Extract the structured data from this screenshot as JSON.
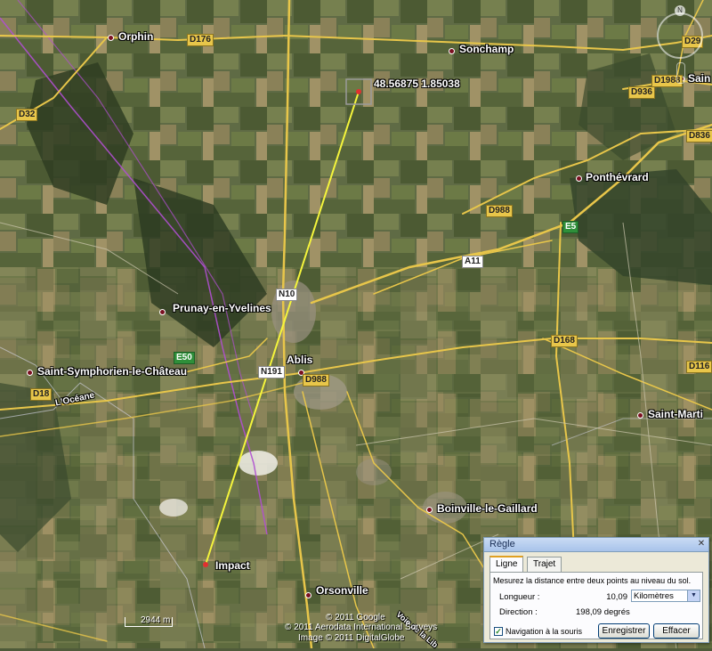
{
  "map": {
    "towns": [
      {
        "name": "Orphin"
      },
      {
        "name": "Sonchamp"
      },
      {
        "name": "Sain"
      },
      {
        "name": "Ponthévrard"
      },
      {
        "name": "Prunay-en-Yvelines"
      },
      {
        "name": "Ablis"
      },
      {
        "name": "Saint-Symphorien-le-Château"
      },
      {
        "name": "Saint-Marti"
      },
      {
        "name": "Boinville-le-Gaillard"
      },
      {
        "name": "Orsonville"
      }
    ],
    "roads": [
      "D176",
      "D29",
      "D32",
      "D936",
      "D1988",
      "D836",
      "D988",
      "E5",
      "A11",
      "N10",
      "E50",
      "N191",
      "D988",
      "D168",
      "D116",
      "D18"
    ],
    "highway_label": "L'Océane",
    "coord_label": "48.56875 1.85038",
    "impact_label": "Impact",
    "scale_label": "2944 m",
    "copyright": [
      "© 2011 Google",
      "© 2011 Aerodata International Surveys",
      "Image © 2011 DigitalGlobe"
    ],
    "partial_label": "Voie de la Lib"
  },
  "ruler": {
    "title": "Règle",
    "tabs": [
      "Ligne",
      "Trajet"
    ],
    "description": "Mesurez la distance entre deux points au niveau du sol.",
    "length_label": "Longueur :",
    "length_value": "10,09",
    "unit": "Kilomètres",
    "direction_label": "Direction :",
    "direction_value": "198,09 degrés",
    "nav_checkbox_label": "Navigation à la souris",
    "nav_checked": true,
    "save_button": "Enregistrer",
    "clear_button": "Effacer"
  },
  "colors": {
    "measure_line": "#f5f53c",
    "route_purple": "#b04fd0",
    "town_dot": "#7a1020"
  }
}
